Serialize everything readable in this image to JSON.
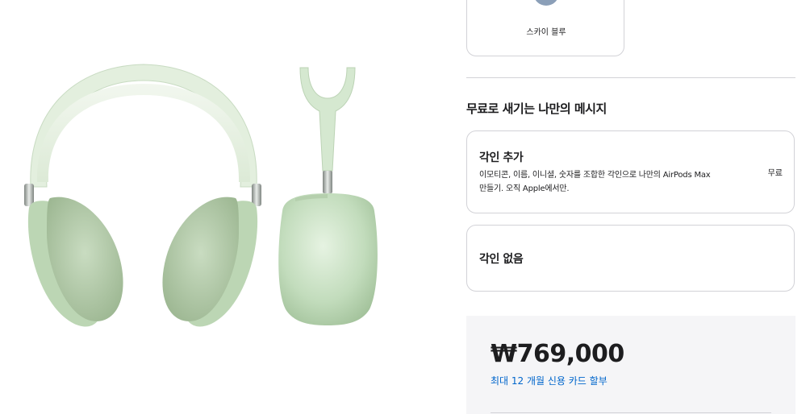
{
  "color_option": {
    "label": "스카이 블루",
    "swatch_color": "#8b9fb8"
  },
  "engraving": {
    "heading": "무료로 새기는 나만의 메시지",
    "options": [
      {
        "title": "각인 추가",
        "description": "이모티콘, 이름, 이니셜, 숫자를 조합한 각인으로 나만의 AirPods Max 만들기. 오직 Apple에서만.",
        "price": "무료"
      },
      {
        "title": "각인 없음"
      }
    ]
  },
  "pricing": {
    "price": "₩769,000",
    "installment": "최대 12 개월 신용 카드 할부"
  },
  "product_image": {
    "icon": "airpods-max-green-image",
    "color": "#cfe6cf"
  },
  "colors": {
    "link": "#0066cc",
    "border": "#d2d2d7",
    "panel": "#f5f5f7"
  }
}
